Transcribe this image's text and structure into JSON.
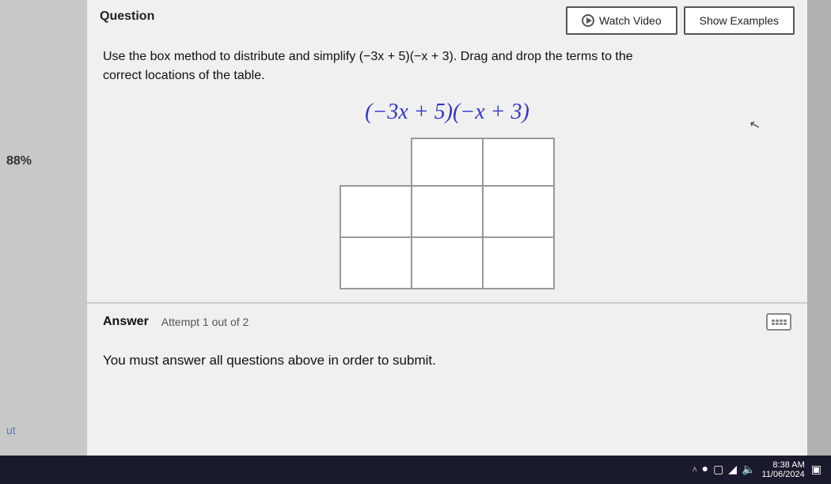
{
  "left_sidebar": {
    "percent": "88%",
    "bottom_link": "ut"
  },
  "header": {
    "question_label": "Question",
    "watch_video_btn": "Watch Video",
    "show_examples_btn": "Show Examples"
  },
  "question": {
    "instruction": "Use the box method to distribute and simplify (−3x + 5)(−x + 3). Drag and drop the terms to the correct locations of the table.",
    "math_expr": "(−3x + 5)(−x + 3)"
  },
  "answer": {
    "label": "Answer",
    "attempt_text": "Attempt 1 out of 2",
    "submit_message": "You must answer all questions above in order to submit."
  },
  "taskbar": {
    "time": "8:38 AM",
    "date": "11/06/2024"
  }
}
